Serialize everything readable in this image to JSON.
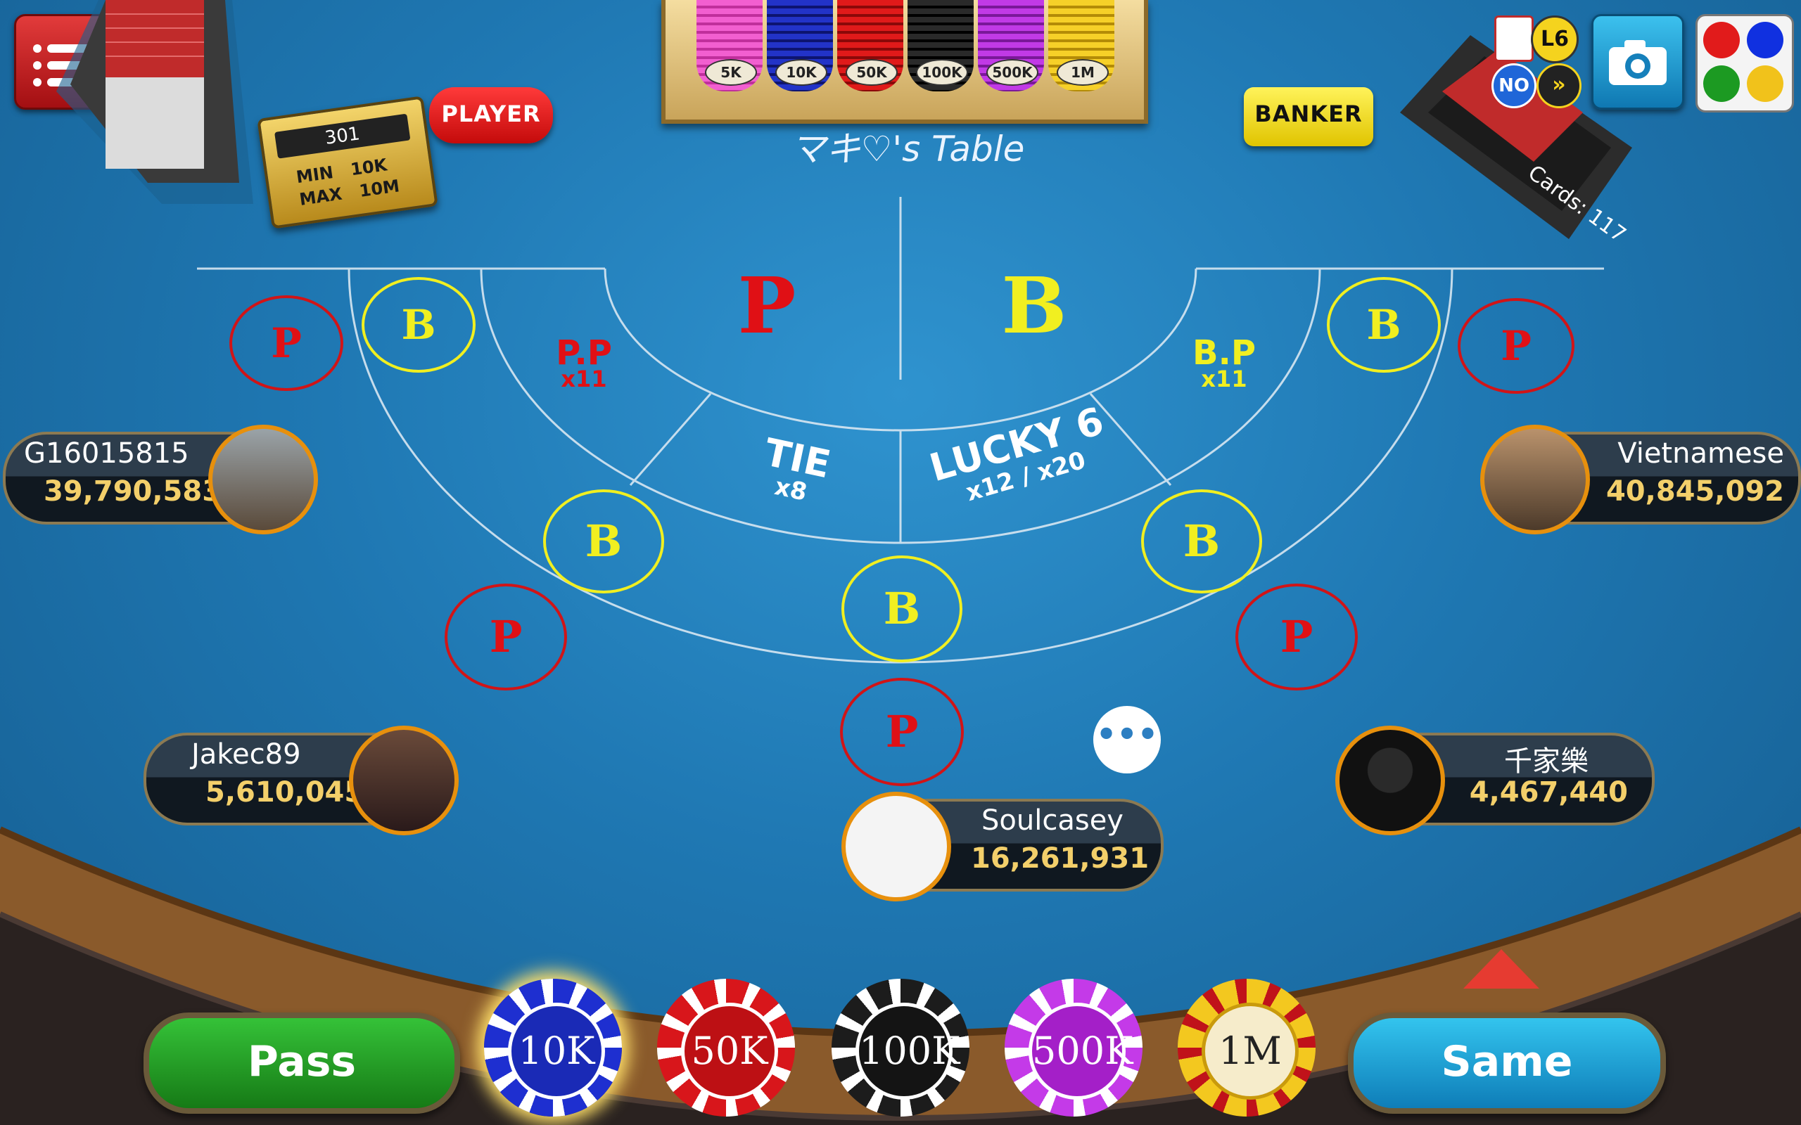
{
  "table": {
    "name": "マキ♡'s Table",
    "number": "301",
    "min_label": "MIN",
    "min_value": "10K",
    "max_label": "MAX",
    "max_value": "10M",
    "player_label": "PLAYER",
    "banker_label": "BANKER",
    "cards_remaining": "Cards: 117"
  },
  "tray_chips": [
    "5K",
    "10K",
    "50K",
    "100K",
    "500K",
    "1M"
  ],
  "status": {
    "level": "L6",
    "no": "NO",
    "fast": "»"
  },
  "zones": {
    "player": "P",
    "banker": "B",
    "player_pair": "P.P",
    "player_pair_odds": "x11",
    "banker_pair": "B.P",
    "banker_pair_odds": "x11",
    "tie": "TIE",
    "tie_odds": "x8",
    "lucky6": "LUCKY 6",
    "lucky6_odds": "x12 / x20"
  },
  "seat_bet_labels": {
    "p": "P",
    "b": "B"
  },
  "players": [
    {
      "name": "G16015815",
      "balance": "39,790,583"
    },
    {
      "name": "Vietnamese",
      "balance": "40,845,092"
    },
    {
      "name": "Jakec89",
      "balance": "5,610,045"
    },
    {
      "name": "千家樂",
      "balance": "4,467,440"
    },
    {
      "name": "Soulcasey",
      "balance": "16,261,931"
    }
  ],
  "chat": {
    "icon_text": "•••"
  },
  "controls": {
    "pass": "Pass",
    "same": "Same",
    "chips": [
      "10K",
      "50K",
      "100K",
      "500K",
      "1M"
    ]
  },
  "colors": {
    "felt": "#1f78b3",
    "player_red": "#e01015",
    "banker_yellow": "#f1ef20",
    "balance_gold": "#f3cf6a"
  }
}
